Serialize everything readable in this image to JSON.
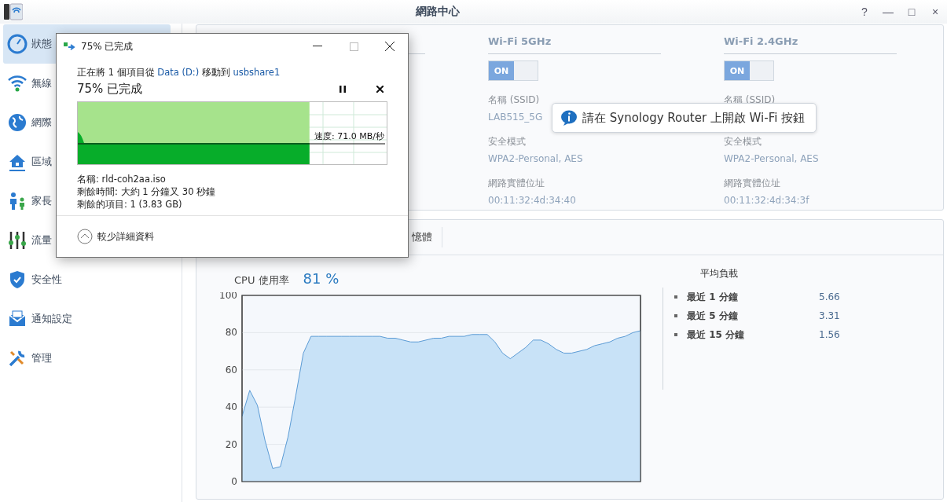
{
  "window": {
    "title": "網路中心",
    "controls": [
      "?",
      "—",
      "□",
      "×"
    ]
  },
  "sidebar": {
    "items": [
      {
        "label": "狀態",
        "selected": true
      },
      {
        "label": "無線",
        "selected": false
      },
      {
        "label": "網際",
        "selected": false
      },
      {
        "label": "區域",
        "selected": false
      },
      {
        "label": "家長",
        "selected": false
      },
      {
        "label": "流量",
        "selected": false
      },
      {
        "label": "安全性",
        "selected": false
      },
      {
        "label": "通知設定",
        "selected": false
      },
      {
        "label": "管理",
        "selected": false
      }
    ]
  },
  "wifi": [
    {
      "title": "Wi-Fi 5GHz",
      "on": true,
      "switch_label": "ON",
      "fields": [
        {
          "label": "名稱 (SSID)",
          "value": "LAB515_5G"
        },
        {
          "label": "安全模式",
          "value": "WPA2-Personal, AES"
        },
        {
          "label": "網路實體位址",
          "value": "00:11:32:4d:34:40"
        }
      ]
    },
    {
      "title": "Wi-Fi 2.4GHz",
      "on": true,
      "switch_label": "ON",
      "fields": [
        {
          "label": "名稱 (SSID)"
        },
        {
          "label": "安全模式",
          "value": "WPA2-Personal, AES"
        },
        {
          "label": "網路實體位址",
          "value": "00:11:32:4d:34:3f"
        }
      ]
    }
  ],
  "tooltip": {
    "text": "請在 Synology Router 上開啟 Wi-Fi 按鈕"
  },
  "tabs": [
    {
      "label": "憶體",
      "selected": false
    }
  ],
  "cpu": {
    "label": "CPU 使用率",
    "value": "81 %",
    "chart_data": {
      "type": "area",
      "categories": [
        null,
        null,
        null,
        null,
        null,
        null,
        null,
        null,
        null,
        null,
        null,
        null,
        null,
        null,
        null,
        null,
        null,
        null,
        null,
        null,
        null,
        null,
        null,
        null,
        null,
        null,
        null,
        null,
        null,
        null,
        null,
        null,
        null,
        null,
        null,
        null,
        null,
        null,
        null,
        null,
        null,
        null,
        null,
        null,
        null,
        null,
        null,
        null,
        null,
        null,
        null,
        null,
        null
      ],
      "series": [
        {
          "color": "#5b9bd5",
          "values": [
            35,
            49,
            41,
            22,
            7,
            8,
            24,
            46,
            69,
            78,
            78,
            78,
            78,
            78,
            78,
            78,
            78,
            78,
            78,
            77,
            77,
            76,
            75,
            75,
            76,
            77,
            77,
            78,
            78,
            78,
            79,
            79,
            79,
            75,
            69,
            66,
            69,
            72,
            76,
            76,
            74,
            71,
            69,
            69,
            70,
            71,
            73,
            74,
            75,
            77,
            78,
            80,
            81
          ]
        }
      ],
      "ylim": [
        0,
        100
      ],
      "yticks": [
        0,
        20,
        40,
        60,
        80,
        100
      ],
      "grid": true
    }
  },
  "load": {
    "title": "平均負載",
    "rows": [
      {
        "label": "最近 1 分鐘",
        "value": "5.66"
      },
      {
        "label": "最近 5 分鐘",
        "value": "3.31"
      },
      {
        "label": "最近 15 分鐘",
        "value": "1.56"
      }
    ]
  },
  "copy_dialog": {
    "title": "75% 已完成",
    "description": [
      {
        "text": "正在將 1 個項目從 ",
        "kind": "plain"
      },
      {
        "text": "Data (D:)",
        "kind": "link"
      },
      {
        "text": " 移動到 ",
        "kind": "plain"
      },
      {
        "text": "usbshare1",
        "kind": "link"
      }
    ],
    "heading": "75% 已完成",
    "level": 0.75,
    "speed": "速度: 71.0 MB/秒",
    "details": [
      "名稱: rld-coh2aa.iso",
      "剩餘時間: 大約 1 分鐘又 30 秒鐘",
      "剩餘的項目: 1 (3.83 GB)"
    ],
    "toggle": "較少詳細資料"
  }
}
